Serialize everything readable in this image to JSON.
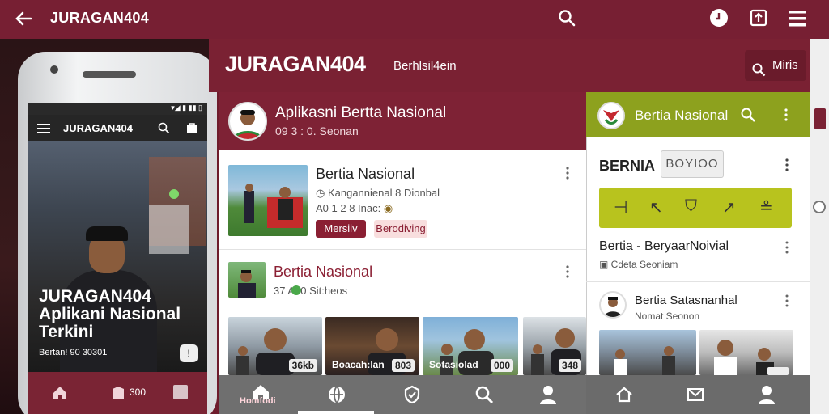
{
  "topbar": {
    "title": "JURAGAN404"
  },
  "phone": {
    "status": "▾◢ ▮ ▮▮ ▯",
    "app_title": "JURAGAN404",
    "overlay_title_line1": "JURAGAN404",
    "overlay_title_line2": "Aplikani Nasional",
    "overlay_title_line3": "Terkini",
    "caption": "Bertan! 90 30301",
    "nav_label": "300",
    "badge": "!"
  },
  "main_header": {
    "title": "JURAGAN404",
    "subtitle": "Berhlsil4ein",
    "search_label": "Miris"
  },
  "feed_header": {
    "title": "Aplikasni Bertta Nasional",
    "meta": "09 3 : 0.  Seonan"
  },
  "card1": {
    "title": "Bertia Nasional",
    "meta1": "Kangannienal  8 Dionbal",
    "meta2": "A0 1 2 8 Inac:",
    "btn_primary": "Mersiiv",
    "btn_secondary": "Berodiving"
  },
  "card2": {
    "title": "Bertia Nasional",
    "meta": "37  A00 Sit:heos"
  },
  "tiles": [
    {
      "label": "",
      "badge": "36kb"
    },
    {
      "label": "Boacah:lan",
      "badge": "803"
    },
    {
      "label": "Sotasiolad",
      "badge": "000"
    },
    {
      "label": "",
      "badge": "348"
    }
  ],
  "bottom_nav": {
    "home_label": "Homfodi"
  },
  "right_panel": {
    "header_title": "Bertia Nasional",
    "tag": "BERNIA",
    "tag_button": "BOYIOO",
    "item1_title": "Bertia - BeryaarNoivial",
    "item1_meta": "Cdeta  Seoniam",
    "item2_title": "Bertia Satasnanhal",
    "item2_meta": "Nomat  Seonon"
  }
}
